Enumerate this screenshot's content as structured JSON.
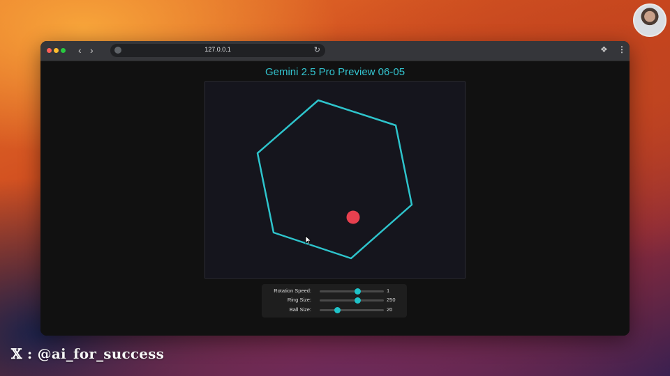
{
  "browser": {
    "url": "127.0.0.1",
    "nav": {
      "back_icon": "chevron-left-icon",
      "forward_icon": "chevron-right-icon"
    }
  },
  "page": {
    "title": "Gemini 2.5 Pro Preview 06-05",
    "accent_color": "#33c4cf",
    "ball_color": "#e8404f"
  },
  "controls": [
    {
      "label": "Rotation Speed:",
      "value": "1",
      "fraction": 0.59
    },
    {
      "label": "Ring Size:",
      "value": "250",
      "fraction": 0.59
    },
    {
      "label": "Ball Size:",
      "value": "20",
      "fraction": 0.28
    }
  ],
  "watermark": {
    "text": "𝕏 : @ai_for_success"
  }
}
